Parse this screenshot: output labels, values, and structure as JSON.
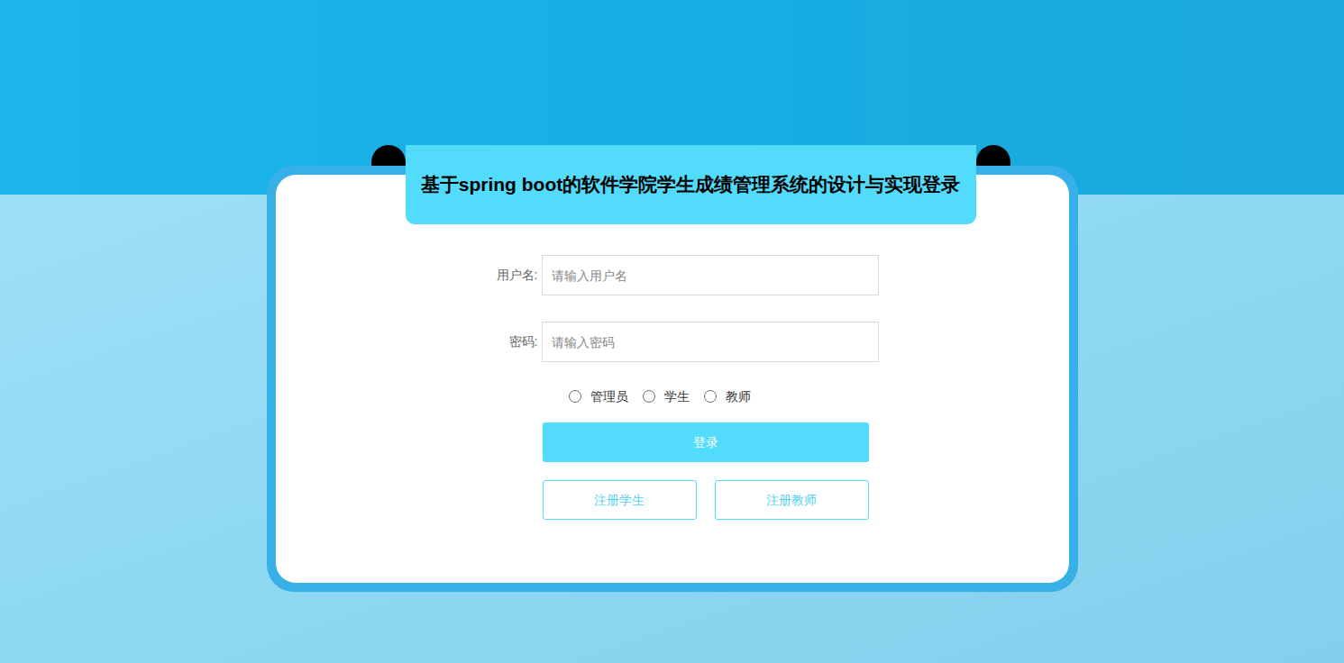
{
  "title": "基于spring boot的软件学院学生成绩管理系统的设计与实现登录",
  "fields": [
    {
      "label": "用户名:",
      "placeholder": "请输入用户名",
      "type": "text"
    },
    {
      "label": "密码:",
      "placeholder": "请输入密码",
      "type": "password"
    }
  ],
  "roles": [
    {
      "label": "管理员",
      "selected": false
    },
    {
      "label": "学生",
      "selected": false
    },
    {
      "label": "教师",
      "selected": false
    }
  ],
  "login_button": "登录",
  "register_buttons": [
    "注册学生",
    "注册教师"
  ]
}
